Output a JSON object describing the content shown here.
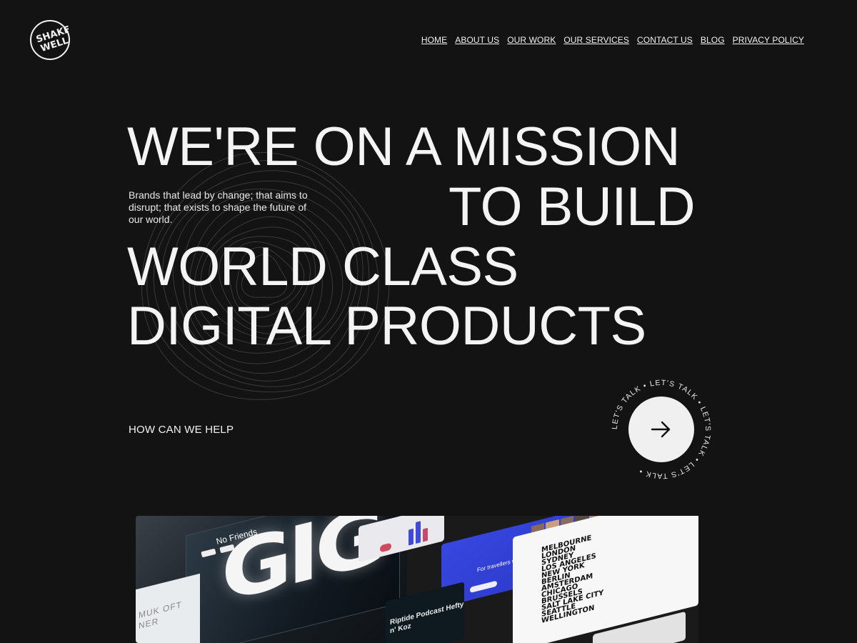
{
  "brand": {
    "logo_text": "SHAKE WELL"
  },
  "nav": {
    "items": [
      "HOME",
      "ABOUT US",
      "OUR WORK",
      "OUR SERVICES",
      "CONTACT US",
      "BLOG",
      "PRIVACY POLICY"
    ]
  },
  "hero": {
    "line1": "WE'RE ON A MISSION",
    "line2": "TO BUILD",
    "line3": "WORLD CLASS",
    "line4": "DIGITAL PRODUCTS",
    "tagline": "Brands that lead by change; that aims to disrupt; that exists to shape the future of our world."
  },
  "help": {
    "label": "HOW CAN WE HELP"
  },
  "cta": {
    "ring_text": "LET'S TALK • LET'S TALK • LET'S TALK • LET'S TALK • "
  },
  "showcase": {
    "card1_title": "No Friends",
    "card1_side": "MUK OFT NER",
    "card3_caption": "For travellers who love creativity",
    "card4_cities": [
      "MELBOURNE",
      "LONDON",
      "SYDNEY",
      "LOS ANGELES",
      "NEW YORK",
      "BERLIN",
      "AMSTERDAM",
      "CHICAGO",
      "BRUSSELS",
      "SALT LAKE CITY",
      "SEATTLE",
      "WELLINGTON"
    ],
    "card5_text": "Riptide Podcast Hefty n' Koz"
  },
  "colors": {
    "background": "#131313",
    "text": "#f2f2f2",
    "cta_circle": "#f0f0f0",
    "accent_blue": "#3747e0"
  }
}
